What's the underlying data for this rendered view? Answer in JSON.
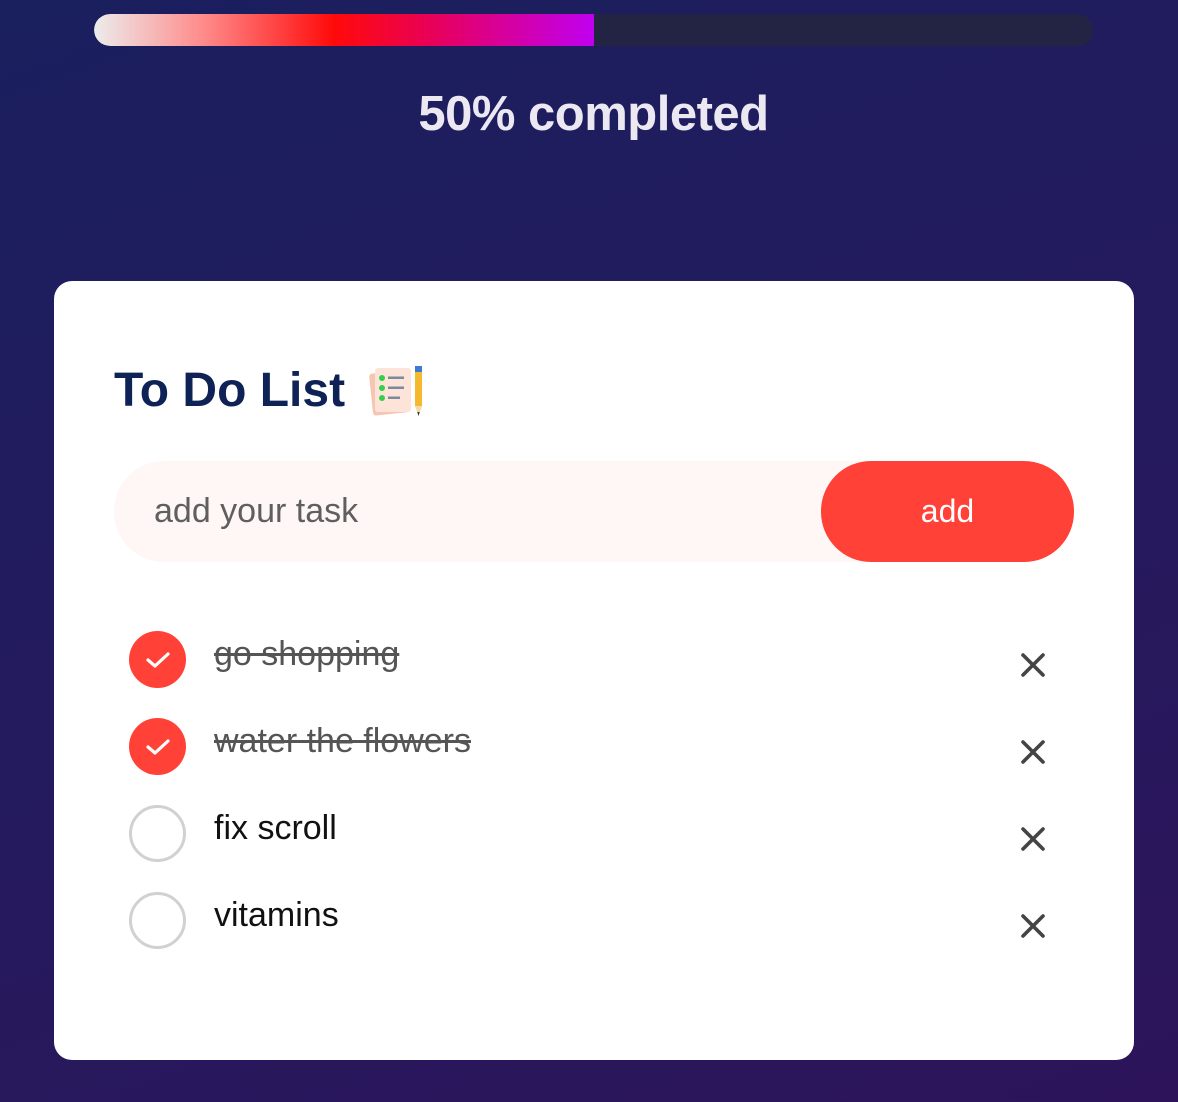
{
  "progress": {
    "fraction": 0.5,
    "label": "50% completed"
  },
  "card": {
    "title": "To Do List",
    "title_icon": "notepad-pencil-icon"
  },
  "input": {
    "placeholder": "add your task",
    "value": ""
  },
  "add_button": {
    "label": "add"
  },
  "tasks": [
    {
      "label": "go shopping",
      "done": true
    },
    {
      "label": "water the flowers",
      "done": true
    },
    {
      "label": "fix scroll",
      "done": false
    },
    {
      "label": "vitamins",
      "done": false
    }
  ],
  "colors": {
    "accent": "#ff4137",
    "title": "#0e2256",
    "background_start": "#1a1f5e",
    "background_end": "#2d145a"
  }
}
